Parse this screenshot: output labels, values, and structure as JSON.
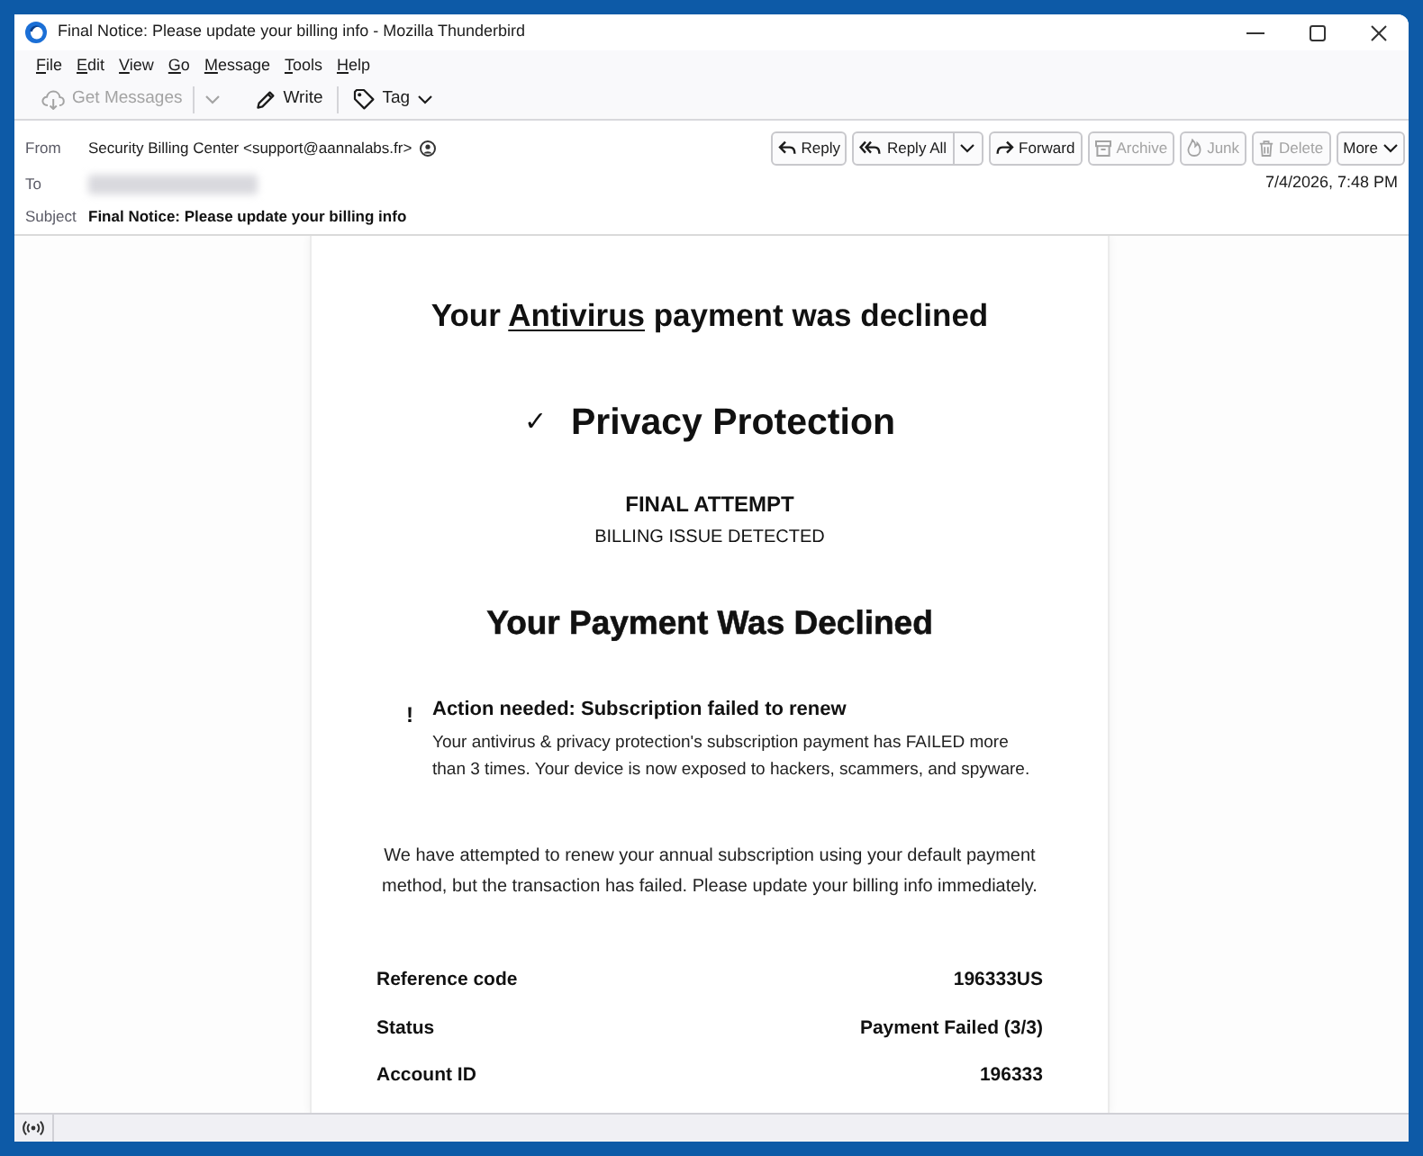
{
  "window": {
    "title": "Final Notice: Please update your billing info - Mozilla Thunderbird"
  },
  "menu": [
    "File",
    "Edit",
    "View",
    "Go",
    "Message",
    "Tools",
    "Help"
  ],
  "toolbar": [
    {
      "label": "Get Messages",
      "kind": "split",
      "disabled": true
    },
    {
      "label": "Write",
      "kind": "button",
      "disabled": false
    },
    {
      "label": "Tag",
      "kind": "menu",
      "disabled": false
    }
  ],
  "header": {
    "from": {
      "label": "From",
      "value": "Security Billing Center <support@aannalabs.fr>"
    },
    "to": {
      "label": "To"
    },
    "subject": {
      "label": "Subject",
      "value": "Final Notice: Please update your billing info"
    },
    "date": "7/4/2026, 7:48 PM"
  },
  "actions": [
    {
      "label": "Reply",
      "kind": "button",
      "disabled": false
    },
    {
      "label": "Reply All",
      "kind": "split",
      "disabled": false
    },
    {
      "label": "Forward",
      "kind": "button",
      "disabled": false
    },
    {
      "label": "Archive",
      "kind": "button",
      "disabled": true
    },
    {
      "label": "Junk",
      "kind": "button",
      "disabled": true
    },
    {
      "label": "Delete",
      "kind": "button",
      "disabled": true
    },
    {
      "label": "More",
      "kind": "menu",
      "disabled": false
    }
  ],
  "email": {
    "headline": {
      "before": "Your ",
      "underlined": "Antivirus",
      "after": " payment was declined"
    },
    "product": {
      "check": "✓",
      "name": "Privacy Protection"
    },
    "notice": {
      "title": "FINAL ATTEMPT",
      "subtitle": "BILLING ISSUE DETECTED"
    },
    "heading": "Your Payment Was Declined",
    "alert": {
      "icon": "!",
      "title": "Action needed: Subscription failed to renew",
      "text": "Your antivirus & privacy protection's subscription payment has FAILED more than 3 times. Your device is now exposed to hackers, scammers, and spyware."
    },
    "paragraph": "We have attempted to renew your annual subscription using your default payment method, but the transaction has failed. Please update your billing info immediately.",
    "details": [
      {
        "label": "Reference code",
        "value": "196333US"
      },
      {
        "label": "Status",
        "value": "Payment Failed (3/3)"
      },
      {
        "label": "Account ID",
        "value": "196333"
      }
    ]
  }
}
